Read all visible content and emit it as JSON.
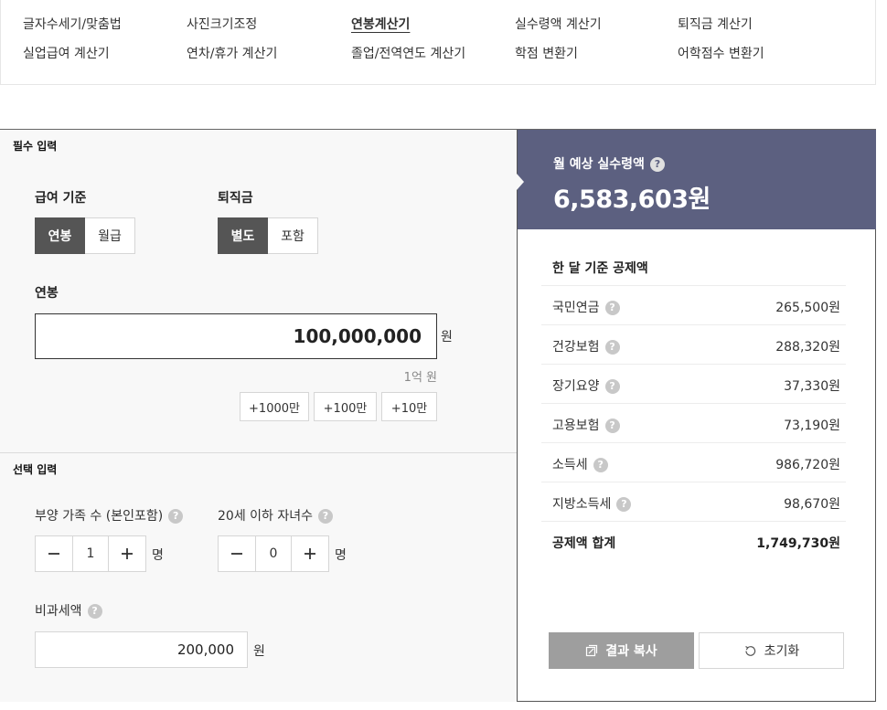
{
  "nav": {
    "items": [
      {
        "label": "글자수세기/맞춤법"
      },
      {
        "label": "사진크기조정"
      },
      {
        "label": "연봉계산기"
      },
      {
        "label": "실수령액 계산기"
      },
      {
        "label": "퇴직금 계산기"
      },
      {
        "label": "실업급여 계산기"
      },
      {
        "label": "연차/휴가 계산기"
      },
      {
        "label": "졸업/전역연도 계산기"
      },
      {
        "label": "학점 변환기"
      },
      {
        "label": "어학점수 변환기"
      }
    ],
    "active": "연봉계산기"
  },
  "required": {
    "title": "필수 입력",
    "salary_basis": {
      "label": "급여 기준",
      "options": [
        "연봉",
        "월급"
      ],
      "selected": "연봉"
    },
    "severance": {
      "label": "퇴직금",
      "options": [
        "별도",
        "포함"
      ],
      "selected": "별도"
    },
    "salary": {
      "label": "연봉",
      "value": "100,000,000",
      "unit": "원",
      "hint": "1억 원"
    },
    "quick_buttons": [
      "+1000만",
      "+100만",
      "+10만"
    ]
  },
  "optional": {
    "title": "선택 입력",
    "dependents": {
      "label": "부양 가족 수 (본인포함)",
      "value": "1",
      "unit": "명"
    },
    "children": {
      "label": "20세 이하 자녀수",
      "value": "0",
      "unit": "명"
    },
    "nontaxable": {
      "label": "비과세액",
      "value": "200,000",
      "unit": "원"
    }
  },
  "result": {
    "label": "월 예상 실수령액",
    "amount": "6,583,603원",
    "deductions_title": "한 달 기준 공제액",
    "deductions": [
      {
        "name": "국민연금",
        "value": "265,500원"
      },
      {
        "name": "건강보험",
        "value": "288,320원"
      },
      {
        "name": "장기요양",
        "value": "37,330원"
      },
      {
        "name": "고용보험",
        "value": "73,190원"
      },
      {
        "name": "소득세",
        "value": "986,720원"
      },
      {
        "name": "지방소득세",
        "value": "98,670원"
      }
    ],
    "total": {
      "name": "공제액 합계",
      "value": "1,749,730원"
    },
    "copy_label": "결과 복사",
    "reset_label": "초기화"
  },
  "help_icon_glyph": "?",
  "colors": {
    "accent_panel": "#5c6080",
    "selected_btn": "#555555",
    "copy_btn": "#9e9e9e"
  }
}
